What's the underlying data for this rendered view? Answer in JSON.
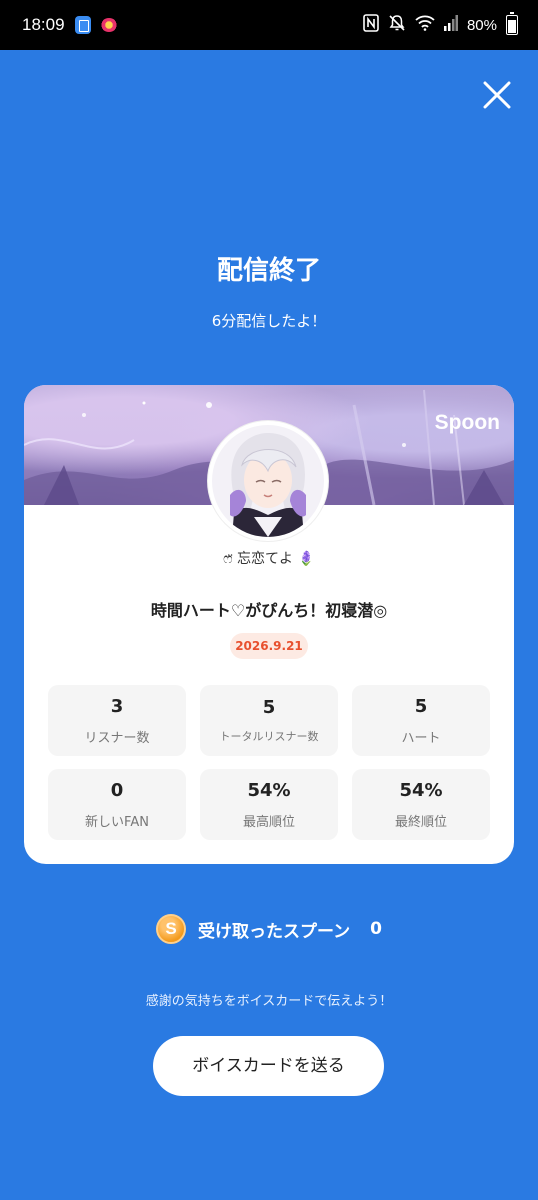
{
  "status_bar": {
    "time": "18:09",
    "battery": "80%",
    "icons": [
      "nfc-icon",
      "mute-icon",
      "wifi-icon",
      "signal-icon",
      "battery-icon"
    ]
  },
  "header": {
    "title": "配信終了",
    "subtitle": "6分配信したよ！"
  },
  "card": {
    "brand": "Spoon",
    "host_name": "ෆ̈ 忘恋てよ",
    "host_emoji": "🪻",
    "stream_title": "時間ハート♡がぴんち！初寝潜◎",
    "date": "2026.9.21",
    "stats": [
      {
        "value": "3",
        "label": "リスナー数"
      },
      {
        "value": "5",
        "label": "トータルリスナー数"
      },
      {
        "value": "5",
        "label": "ハート"
      },
      {
        "value": "0",
        "label": "新しいFAN"
      },
      {
        "value": "54%",
        "label": "最高順位"
      },
      {
        "value": "54%",
        "label": "最終順位"
      }
    ]
  },
  "received": {
    "label": "受け取ったスプーン",
    "count": "0",
    "coin_symbol": "S"
  },
  "footer": {
    "thanks_text": "感謝の気持ちをボイスカードで伝えよう！",
    "button_label": "ボイスカードを送る"
  },
  "colors": {
    "background": "#2a7ae2",
    "date_badge_text": "#e8502e",
    "coin": "#f39a1c"
  }
}
